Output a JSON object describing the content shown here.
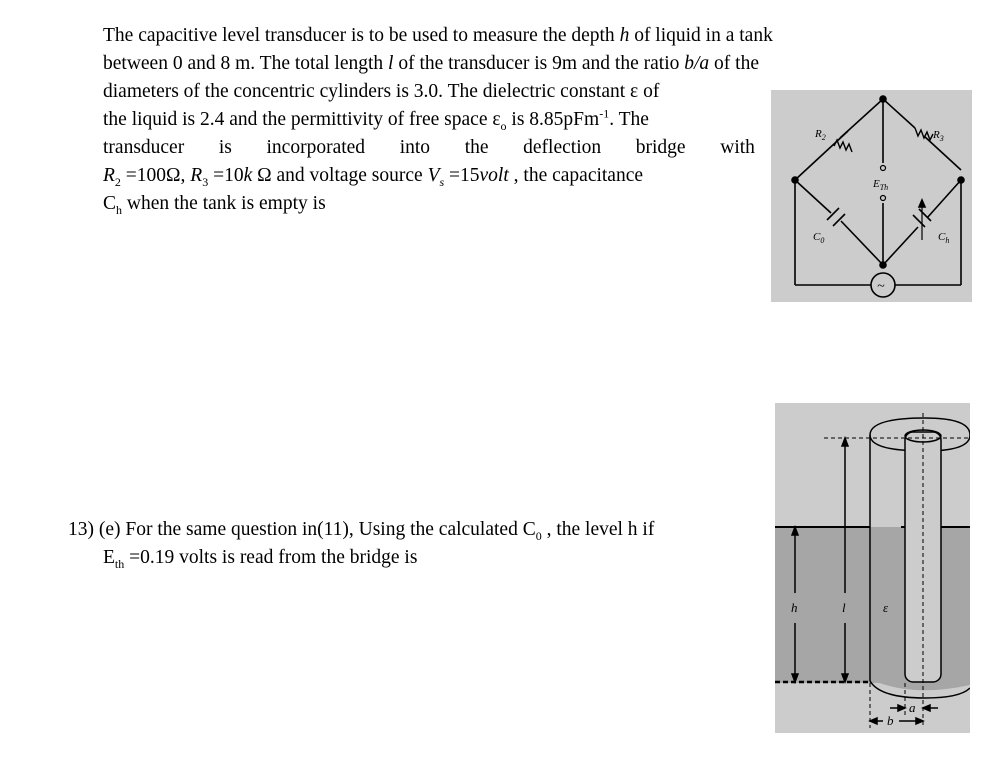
{
  "question_12": {
    "lines": [
      [
        "The capacitive level transducer is to be used to measure the depth ",
        "h",
        " of liquid in a tank"
      ],
      [
        "between 0 and 8 m. The total length ",
        "l",
        " of the transducer is 9m and the ratio ",
        "b/a",
        " of the"
      ],
      "diameters of the concentric cylinders is 3.0. The dielectric constant ε of",
      [
        "the liquid is 2.4 and the permittivity of free space ε",
        "o",
        " is 8.85pFm",
        "-1",
        ". The"
      ],
      [
        "transducer",
        "is",
        "incorporated",
        "into",
        "the",
        "deflection",
        "bridge",
        "with"
      ],
      [
        "R",
        "2",
        " =100Ω, ",
        "R",
        "3",
        " =10",
        "k",
        " Ω and voltage source ",
        "V",
        "s",
        " =15",
        "volt",
        " , the capacitance"
      ],
      [
        "C",
        "h",
        " when the tank is empty is"
      ]
    ]
  },
  "question_13": {
    "line1": "13) (e) For the same question in(11), Using the calculated C",
    "line1_sub": "0",
    "line1_end": " , the level h if",
    "line2_start": "E",
    "line2_sub": "th",
    "line2_end": " =0.19 volts is read from the bridge is"
  },
  "circuit_diagram": {
    "labels": {
      "r2": "R",
      "r2_sub": "2",
      "r3": "R",
      "r3_sub": "3",
      "eth": "E",
      "eth_sub": "Th",
      "c0": "C",
      "c0_sub": "0",
      "ch": "C",
      "ch_sub": "h",
      "source": "~"
    }
  },
  "tank_diagram": {
    "labels": {
      "h": "h",
      "l": "l",
      "epsilon": "ε",
      "a": "a",
      "b": "b"
    }
  }
}
